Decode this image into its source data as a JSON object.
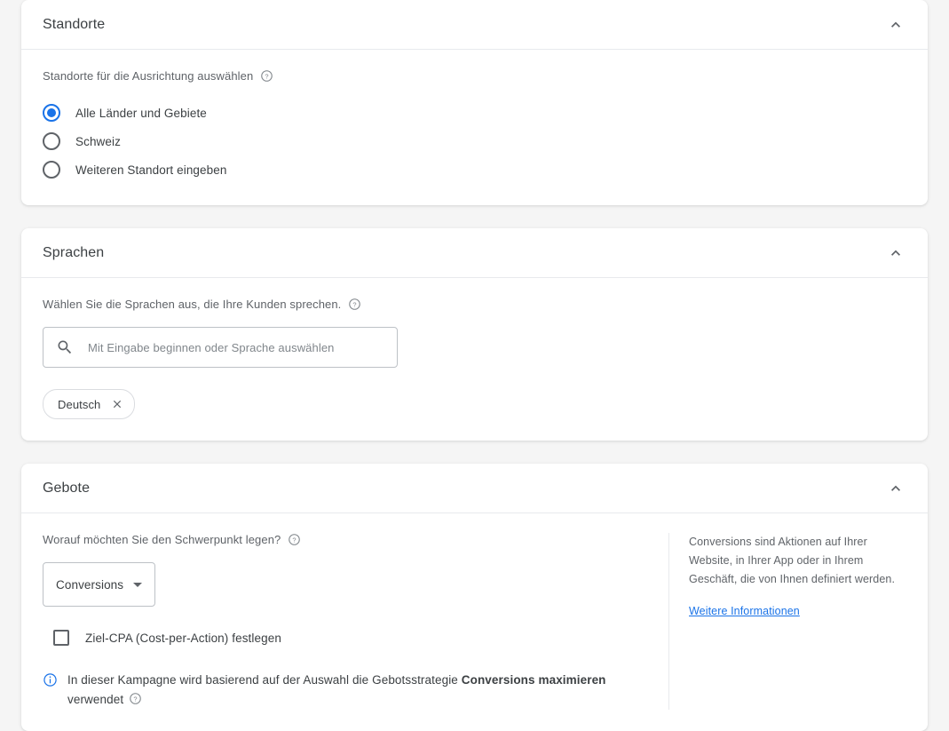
{
  "sections": {
    "locations": {
      "title": "Standorte",
      "collapse_icon": "chevron-up-icon",
      "field_label": "Standorte für die Ausrichtung auswählen",
      "help_icon": "help-circle-icon",
      "options": [
        {
          "label": "Alle Länder und Gebiete",
          "selected": true
        },
        {
          "label": "Schweiz",
          "selected": false
        },
        {
          "label": "Weiteren Standort eingeben",
          "selected": false
        }
      ]
    },
    "languages": {
      "title": "Sprachen",
      "collapse_icon": "chevron-up-icon",
      "field_label": "Wählen Sie die Sprachen aus, die Ihre Kunden sprechen.",
      "help_icon": "help-circle-icon",
      "search": {
        "icon": "search-icon",
        "placeholder": "Mit Eingabe beginnen oder Sprache auswählen",
        "value": ""
      },
      "chips": [
        {
          "label": "Deutsch",
          "remove_icon": "close-icon"
        }
      ]
    },
    "bids": {
      "title": "Gebote",
      "collapse_icon": "chevron-up-icon",
      "field_label": "Worauf möchten Sie den Schwerpunkt legen?",
      "help_icon": "help-circle-icon",
      "dropdown": {
        "value": "Conversions",
        "icon": "chevron-down-icon",
        "options": [
          "Conversions"
        ]
      },
      "checkbox": {
        "label": "Ziel-CPA (Cost-per-Action) festlegen",
        "checked": false
      },
      "note": {
        "icon": "info-circle-icon",
        "text_before": "In dieser Kampagne wird basierend auf der Auswahl die Gebotsstrategie ",
        "strategy": "Conversions maximieren",
        "text_after": " verwendet",
        "help_icon": "help-circle-icon"
      },
      "side_panel": {
        "description": "Conversions sind Aktionen auf Ihrer Website, in Ihrer App oder in Ihrem Geschäft, die von Ihnen definiert werden.",
        "link_label": "Weitere Informationen"
      }
    }
  },
  "colors": {
    "accent": "#1a73e8",
    "page_background": "#f5f5f5",
    "card_background": "#ffffff",
    "text_primary": "#3c4043",
    "text_secondary": "#5f6368",
    "border": "#dadce0"
  }
}
